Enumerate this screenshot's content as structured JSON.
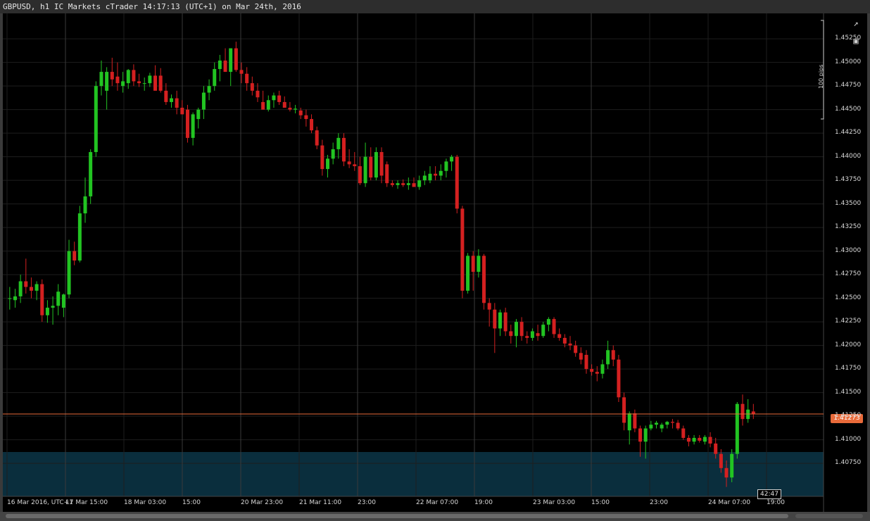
{
  "window": {
    "title": "GBPUSD, h1 IC Markets cTrader 14:17:13 (UTC+1) on Mar 24th, 2016"
  },
  "toolbar": {
    "detach_icon": "external-window-icon",
    "screenshot_icon": "camera-icon"
  },
  "chart_data": {
    "type": "candlestick",
    "symbol": "GBPUSD",
    "timeframe": "h1",
    "y_ticks": [
      "1.45250",
      "1.45000",
      "1.44750",
      "1.44500",
      "1.44250",
      "1.44000",
      "1.43750",
      "1.43500",
      "1.43250",
      "1.43000",
      "1.42750",
      "1.42500",
      "1.42250",
      "1.42000",
      "1.41750",
      "1.41500",
      "1.41250",
      "1.41000",
      "1.40750"
    ],
    "ylim": [
      1.404,
      1.4552
    ],
    "x_ticks": [
      "16 Mar 2016, UTC+1",
      "17 Mar 15:00",
      "18 Mar 03:00",
      "15:00",
      "20 Mar 23:00",
      "21 Mar 11:00",
      "23:00",
      "22 Mar 07:00",
      "19:00",
      "23 Mar 03:00",
      "15:00",
      "23:00",
      "24 Mar 07:00",
      "19:00"
    ],
    "current_price": "1.41273",
    "current_price_value": 1.41273,
    "countdown": "42:47",
    "pips_scale_label": "100 pips",
    "colors": {
      "bull": "#22c422",
      "bear": "#d42020",
      "price_line": "#e86a3a",
      "zone": "#0a2e3d"
    },
    "candles": [
      {
        "o": 1.425,
        "h": 1.4262,
        "l": 1.4238,
        "c": 1.425
      },
      {
        "o": 1.4248,
        "h": 1.426,
        "l": 1.424,
        "c": 1.4252
      },
      {
        "o": 1.4252,
        "h": 1.4275,
        "l": 1.4245,
        "c": 1.4268
      },
      {
        "o": 1.4268,
        "h": 1.4292,
        "l": 1.4255,
        "c": 1.4262
      },
      {
        "o": 1.4262,
        "h": 1.4272,
        "l": 1.425,
        "c": 1.4258
      },
      {
        "o": 1.4258,
        "h": 1.4268,
        "l": 1.4248,
        "c": 1.4265
      },
      {
        "o": 1.4265,
        "h": 1.427,
        "l": 1.4225,
        "c": 1.4232
      },
      {
        "o": 1.4232,
        "h": 1.4248,
        "l": 1.4224,
        "c": 1.424
      },
      {
        "o": 1.424,
        "h": 1.4252,
        "l": 1.4222,
        "c": 1.4242
      },
      {
        "o": 1.4242,
        "h": 1.4265,
        "l": 1.4232,
        "c": 1.4257
      },
      {
        "o": 1.424,
        "h": 1.4255,
        "l": 1.423,
        "c": 1.4254
      },
      {
        "o": 1.4254,
        "h": 1.4312,
        "l": 1.425,
        "c": 1.43
      },
      {
        "o": 1.43,
        "h": 1.431,
        "l": 1.4285,
        "c": 1.429
      },
      {
        "o": 1.429,
        "h": 1.4348,
        "l": 1.4288,
        "c": 1.434
      },
      {
        "o": 1.434,
        "h": 1.4378,
        "l": 1.433,
        "c": 1.4358
      },
      {
        "o": 1.4358,
        "h": 1.4408,
        "l": 1.435,
        "c": 1.4405
      },
      {
        "o": 1.4405,
        "h": 1.448,
        "l": 1.44,
        "c": 1.4475
      },
      {
        "o": 1.4475,
        "h": 1.4502,
        "l": 1.4465,
        "c": 1.449
      },
      {
        "o": 1.447,
        "h": 1.4495,
        "l": 1.445,
        "c": 1.449
      },
      {
        "o": 1.449,
        "h": 1.4505,
        "l": 1.4475,
        "c": 1.4482
      },
      {
        "o": 1.4485,
        "h": 1.45,
        "l": 1.447,
        "c": 1.4478
      },
      {
        "o": 1.4475,
        "h": 1.449,
        "l": 1.4468,
        "c": 1.448
      },
      {
        "o": 1.4478,
        "h": 1.4493,
        "l": 1.4472,
        "c": 1.4492
      },
      {
        "o": 1.4492,
        "h": 1.4498,
        "l": 1.4475,
        "c": 1.448
      },
      {
        "o": 1.448,
        "h": 1.4488,
        "l": 1.4474,
        "c": 1.4478
      },
      {
        "o": 1.4478,
        "h": 1.4484,
        "l": 1.447,
        "c": 1.4478
      },
      {
        "o": 1.4478,
        "h": 1.4489,
        "l": 1.4474,
        "c": 1.4486
      },
      {
        "o": 1.4486,
        "h": 1.4497,
        "l": 1.4478,
        "c": 1.447
      },
      {
        "o": 1.4486,
        "h": 1.4494,
        "l": 1.4468,
        "c": 1.447
      },
      {
        "o": 1.447,
        "h": 1.4478,
        "l": 1.4455,
        "c": 1.4458
      },
      {
        "o": 1.4458,
        "h": 1.4466,
        "l": 1.4452,
        "c": 1.4462
      },
      {
        "o": 1.4462,
        "h": 1.447,
        "l": 1.4445,
        "c": 1.4452
      },
      {
        "o": 1.4452,
        "h": 1.446,
        "l": 1.4445,
        "c": 1.4445
      },
      {
        "o": 1.445,
        "h": 1.4455,
        "l": 1.4415,
        "c": 1.442
      },
      {
        "o": 1.442,
        "h": 1.4447,
        "l": 1.4412,
        "c": 1.4445
      },
      {
        "o": 1.444,
        "h": 1.4452,
        "l": 1.443,
        "c": 1.445
      },
      {
        "o": 1.445,
        "h": 1.4475,
        "l": 1.444,
        "c": 1.4468
      },
      {
        "o": 1.4468,
        "h": 1.4482,
        "l": 1.446,
        "c": 1.4475
      },
      {
        "o": 1.4475,
        "h": 1.45,
        "l": 1.447,
        "c": 1.4493
      },
      {
        "o": 1.4493,
        "h": 1.4508,
        "l": 1.448,
        "c": 1.4502
      },
      {
        "o": 1.4502,
        "h": 1.4515,
        "l": 1.449,
        "c": 1.449
      },
      {
        "o": 1.449,
        "h": 1.451,
        "l": 1.4475,
        "c": 1.4515
      },
      {
        "o": 1.4515,
        "h": 1.4522,
        "l": 1.449,
        "c": 1.4492
      },
      {
        "o": 1.4492,
        "h": 1.45,
        "l": 1.4478,
        "c": 1.4488
      },
      {
        "o": 1.4488,
        "h": 1.4495,
        "l": 1.447,
        "c": 1.4478
      },
      {
        "o": 1.4478,
        "h": 1.4485,
        "l": 1.4465,
        "c": 1.447
      },
      {
        "o": 1.447,
        "h": 1.4478,
        "l": 1.4458,
        "c": 1.4463
      },
      {
        "o": 1.4458,
        "h": 1.447,
        "l": 1.445,
        "c": 1.445
      },
      {
        "o": 1.445,
        "h": 1.4465,
        "l": 1.4448,
        "c": 1.446
      },
      {
        "o": 1.446,
        "h": 1.4468,
        "l": 1.4452,
        "c": 1.4465
      },
      {
        "o": 1.4465,
        "h": 1.447,
        "l": 1.4455,
        "c": 1.4458
      },
      {
        "o": 1.4458,
        "h": 1.4464,
        "l": 1.4452,
        "c": 1.4452
      },
      {
        "o": 1.4452,
        "h": 1.4458,
        "l": 1.4448,
        "c": 1.445
      },
      {
        "o": 1.445,
        "h": 1.4455,
        "l": 1.4446,
        "c": 1.4451
      },
      {
        "o": 1.4449,
        "h": 1.4452,
        "l": 1.444,
        "c": 1.4444
      },
      {
        "o": 1.4444,
        "h": 1.445,
        "l": 1.4432,
        "c": 1.444
      },
      {
        "o": 1.444,
        "h": 1.4445,
        "l": 1.4425,
        "c": 1.4428
      },
      {
        "o": 1.4428,
        "h": 1.4432,
        "l": 1.4408,
        "c": 1.4412
      },
      {
        "o": 1.4412,
        "h": 1.4418,
        "l": 1.438,
        "c": 1.4387
      },
      {
        "o": 1.4387,
        "h": 1.4402,
        "l": 1.4378,
        "c": 1.4398
      },
      {
        "o": 1.4398,
        "h": 1.4415,
        "l": 1.4392,
        "c": 1.4408
      },
      {
        "o": 1.4408,
        "h": 1.4425,
        "l": 1.4398,
        "c": 1.442
      },
      {
        "o": 1.442,
        "h": 1.4425,
        "l": 1.439,
        "c": 1.4395
      },
      {
        "o": 1.4395,
        "h": 1.4408,
        "l": 1.4388,
        "c": 1.4392
      },
      {
        "o": 1.4392,
        "h": 1.4405,
        "l": 1.4385,
        "c": 1.439
      },
      {
        "o": 1.439,
        "h": 1.44,
        "l": 1.437,
        "c": 1.4372
      },
      {
        "o": 1.4372,
        "h": 1.4415,
        "l": 1.4368,
        "c": 1.44
      },
      {
        "o": 1.44,
        "h": 1.441,
        "l": 1.4375,
        "c": 1.4378
      },
      {
        "o": 1.4378,
        "h": 1.441,
        "l": 1.4375,
        "c": 1.4405
      },
      {
        "o": 1.4405,
        "h": 1.441,
        "l": 1.4372,
        "c": 1.438
      },
      {
        "o": 1.4392,
        "h": 1.4395,
        "l": 1.4368,
        "c": 1.4372
      },
      {
        "o": 1.4372,
        "h": 1.4375,
        "l": 1.4368,
        "c": 1.437
      },
      {
        "o": 1.437,
        "h": 1.4375,
        "l": 1.4366,
        "c": 1.4372
      },
      {
        "o": 1.4372,
        "h": 1.4376,
        "l": 1.4368,
        "c": 1.437
      },
      {
        "o": 1.437,
        "h": 1.4378,
        "l": 1.4365,
        "c": 1.4372
      },
      {
        "o": 1.4372,
        "h": 1.4378,
        "l": 1.4368,
        "c": 1.4368
      },
      {
        "o": 1.4368,
        "h": 1.438,
        "l": 1.4365,
        "c": 1.4375
      },
      {
        "o": 1.4375,
        "h": 1.4385,
        "l": 1.437,
        "c": 1.438
      },
      {
        "o": 1.4375,
        "h": 1.439,
        "l": 1.4372,
        "c": 1.4382
      },
      {
        "o": 1.4382,
        "h": 1.439,
        "l": 1.4375,
        "c": 1.438
      },
      {
        "o": 1.438,
        "h": 1.4392,
        "l": 1.4375,
        "c": 1.4385
      },
      {
        "o": 1.4385,
        "h": 1.4398,
        "l": 1.4378,
        "c": 1.4395
      },
      {
        "o": 1.4395,
        "h": 1.4402,
        "l": 1.4385,
        "c": 1.44
      },
      {
        "o": 1.44,
        "h": 1.4402,
        "l": 1.434,
        "c": 1.4345
      },
      {
        "o": 1.4345,
        "h": 1.4348,
        "l": 1.425,
        "c": 1.4258
      },
      {
        "o": 1.4258,
        "h": 1.4298,
        "l": 1.4255,
        "c": 1.4295
      },
      {
        "o": 1.4295,
        "h": 1.43,
        "l": 1.4258,
        "c": 1.4278
      },
      {
        "o": 1.4278,
        "h": 1.4302,
        "l": 1.4272,
        "c": 1.4295
      },
      {
        "o": 1.4295,
        "h": 1.4297,
        "l": 1.4238,
        "c": 1.4245
      },
      {
        "o": 1.4245,
        "h": 1.425,
        "l": 1.422,
        "c": 1.4238
      },
      {
        "o": 1.4238,
        "h": 1.4245,
        "l": 1.4192,
        "c": 1.4218
      },
      {
        "o": 1.4218,
        "h": 1.4238,
        "l": 1.421,
        "c": 1.4235
      },
      {
        "o": 1.4235,
        "h": 1.424,
        "l": 1.421,
        "c": 1.4215
      },
      {
        "o": 1.4215,
        "h": 1.4222,
        "l": 1.4202,
        "c": 1.421
      },
      {
        "o": 1.421,
        "h": 1.4228,
        "l": 1.4198,
        "c": 1.4225
      },
      {
        "o": 1.4225,
        "h": 1.423,
        "l": 1.4205,
        "c": 1.421
      },
      {
        "o": 1.421,
        "h": 1.4215,
        "l": 1.4202,
        "c": 1.4208
      },
      {
        "o": 1.4208,
        "h": 1.4218,
        "l": 1.4205,
        "c": 1.4215
      },
      {
        "o": 1.4213,
        "h": 1.4222,
        "l": 1.4205,
        "c": 1.421
      },
      {
        "o": 1.421,
        "h": 1.4225,
        "l": 1.4208,
        "c": 1.4222
      },
      {
        "o": 1.4222,
        "h": 1.423,
        "l": 1.4215,
        "c": 1.4228
      },
      {
        "o": 1.4228,
        "h": 1.423,
        "l": 1.4208,
        "c": 1.4212
      },
      {
        "o": 1.4212,
        "h": 1.4218,
        "l": 1.4205,
        "c": 1.4208
      },
      {
        "o": 1.4208,
        "h": 1.4212,
        "l": 1.4198,
        "c": 1.4202
      },
      {
        "o": 1.4202,
        "h": 1.421,
        "l": 1.4195,
        "c": 1.42
      },
      {
        "o": 1.42,
        "h": 1.4205,
        "l": 1.4188,
        "c": 1.4192
      },
      {
        "o": 1.4192,
        "h": 1.4198,
        "l": 1.418,
        "c": 1.4185
      },
      {
        "o": 1.419,
        "h": 1.4195,
        "l": 1.417,
        "c": 1.4175
      },
      {
        "o": 1.4175,
        "h": 1.418,
        "l": 1.4168,
        "c": 1.4172
      },
      {
        "o": 1.4172,
        "h": 1.4178,
        "l": 1.4162,
        "c": 1.417
      },
      {
        "o": 1.417,
        "h": 1.4185,
        "l": 1.4165,
        "c": 1.418
      },
      {
        "o": 1.418,
        "h": 1.4205,
        "l": 1.4175,
        "c": 1.4195
      },
      {
        "o": 1.4195,
        "h": 1.42,
        "l": 1.4178,
        "c": 1.4185
      },
      {
        "o": 1.4185,
        "h": 1.419,
        "l": 1.414,
        "c": 1.4145
      },
      {
        "o": 1.4145,
        "h": 1.415,
        "l": 1.411,
        "c": 1.4118
      },
      {
        "o": 1.411,
        "h": 1.413,
        "l": 1.4095,
        "c": 1.4128
      },
      {
        "o": 1.4128,
        "h": 1.4132,
        "l": 1.4108,
        "c": 1.4112
      },
      {
        "o": 1.4112,
        "h": 1.4115,
        "l": 1.4082,
        "c": 1.4098
      },
      {
        "o": 1.4098,
        "h": 1.4115,
        "l": 1.408,
        "c": 1.4112
      },
      {
        "o": 1.4112,
        "h": 1.412,
        "l": 1.411,
        "c": 1.4116
      },
      {
        "o": 1.4116,
        "h": 1.412,
        "l": 1.4112,
        "c": 1.4118
      },
      {
        "o": 1.4112,
        "h": 1.4118,
        "l": 1.4108,
        "c": 1.4116
      },
      {
        "o": 1.4116,
        "h": 1.412,
        "l": 1.4112,
        "c": 1.4119
      },
      {
        "o": 1.4119,
        "h": 1.4122,
        "l": 1.4112,
        "c": 1.4118
      },
      {
        "o": 1.4118,
        "h": 1.4121,
        "l": 1.411,
        "c": 1.4112
      },
      {
        "o": 1.4112,
        "h": 1.4115,
        "l": 1.41,
        "c": 1.4102
      },
      {
        "o": 1.4102,
        "h": 1.4105,
        "l": 1.4093,
        "c": 1.4098
      },
      {
        "o": 1.4098,
        "h": 1.4105,
        "l": 1.4095,
        "c": 1.4102
      },
      {
        "o": 1.4102,
        "h": 1.4105,
        "l": 1.4097,
        "c": 1.4099
      },
      {
        "o": 1.4098,
        "h": 1.4105,
        "l": 1.4095,
        "c": 1.4103
      },
      {
        "o": 1.4103,
        "h": 1.4108,
        "l": 1.4092,
        "c": 1.4096
      },
      {
        "o": 1.4096,
        "h": 1.4102,
        "l": 1.408,
        "c": 1.4085
      },
      {
        "o": 1.4085,
        "h": 1.409,
        "l": 1.4065,
        "c": 1.407
      },
      {
        "o": 1.407,
        "h": 1.4078,
        "l": 1.405,
        "c": 1.406
      },
      {
        "o": 1.406,
        "h": 1.409,
        "l": 1.4055,
        "c": 1.4085
      },
      {
        "o": 1.4085,
        "h": 1.414,
        "l": 1.408,
        "c": 1.4138
      },
      {
        "o": 1.4138,
        "h": 1.4148,
        "l": 1.4115,
        "c": 1.4122
      },
      {
        "o": 1.4122,
        "h": 1.4143,
        "l": 1.4118,
        "c": 1.4132
      },
      {
        "o": 1.413,
        "h": 1.4138,
        "l": 1.4122,
        "c": 1.4127
      }
    ]
  }
}
